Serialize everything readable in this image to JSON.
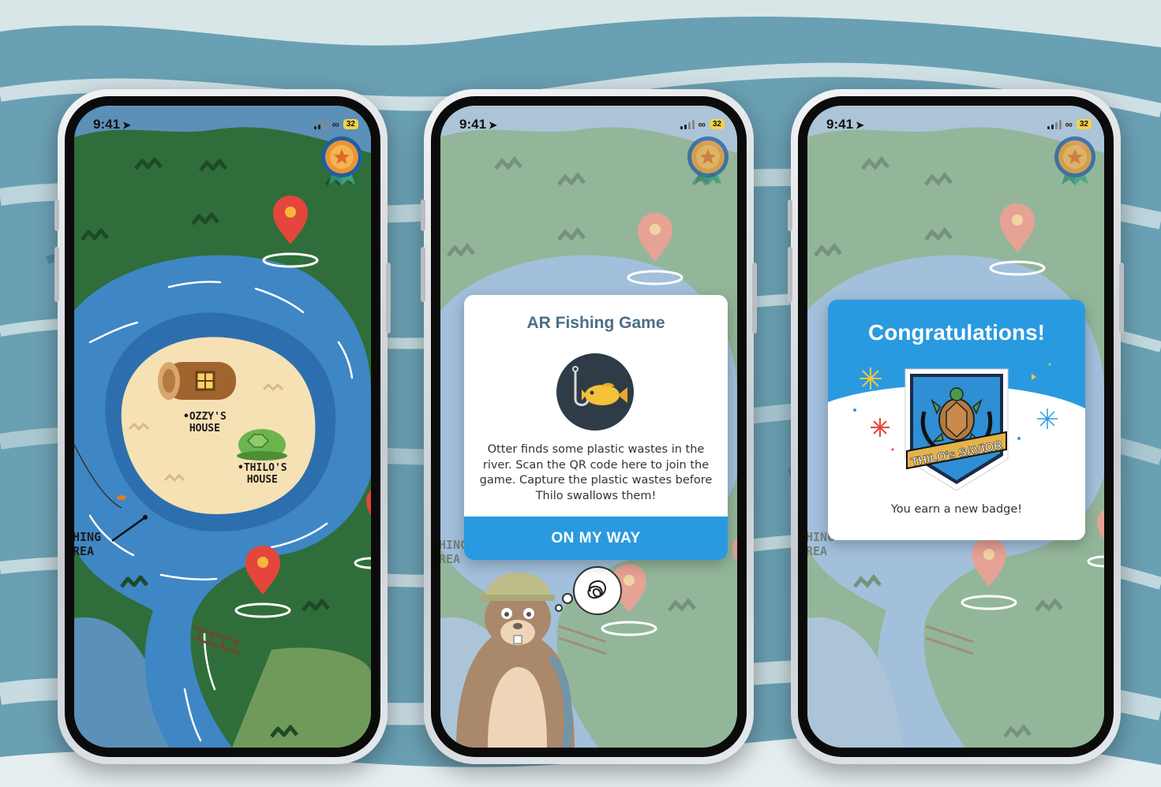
{
  "status_bar": {
    "time": "9:41",
    "battery": "32"
  },
  "screen1": {
    "ozzy_house_label_1": "OZZY'S",
    "ozzy_house_label_2": "HOUSE",
    "thilo_house_label_1": "THILO'S",
    "thilo_house_label_2": "HOUSE",
    "fishing_area_label_1": "HING",
    "fishing_area_label_2": "REA"
  },
  "screen2": {
    "modal_title": "AR Fishing Game",
    "modal_description": "Otter finds some plastic wastes in the river. Scan the QR code here to join the game. Capture the plastic wastes before Thilo swallows them!",
    "cta_label": "ON MY WAY",
    "fishing_area_label_1": "HING",
    "fishing_area_label_2": "REA"
  },
  "screen3": {
    "title": "Congratulations!",
    "badge_text": "THILO's SAVIOR",
    "subtitle": "You earn a new badge!",
    "fishing_area_label_1": "HING",
    "fishing_area_label_2": "REA"
  },
  "colors": {
    "grass": "#2f6e3a",
    "river": "#3f86c4",
    "sand": "#f6e1b4",
    "pin": "#e5463b",
    "accent_blue": "#2a9ae0",
    "title_gray_blue": "#4b6f86"
  },
  "icons": [
    "navigation-arrow-icon",
    "signal-bars-icon",
    "link-icon",
    "battery-icon",
    "medal-icon",
    "map-pin-icon",
    "fishing-hook-fish-icon",
    "turtle-badge-icon"
  ]
}
